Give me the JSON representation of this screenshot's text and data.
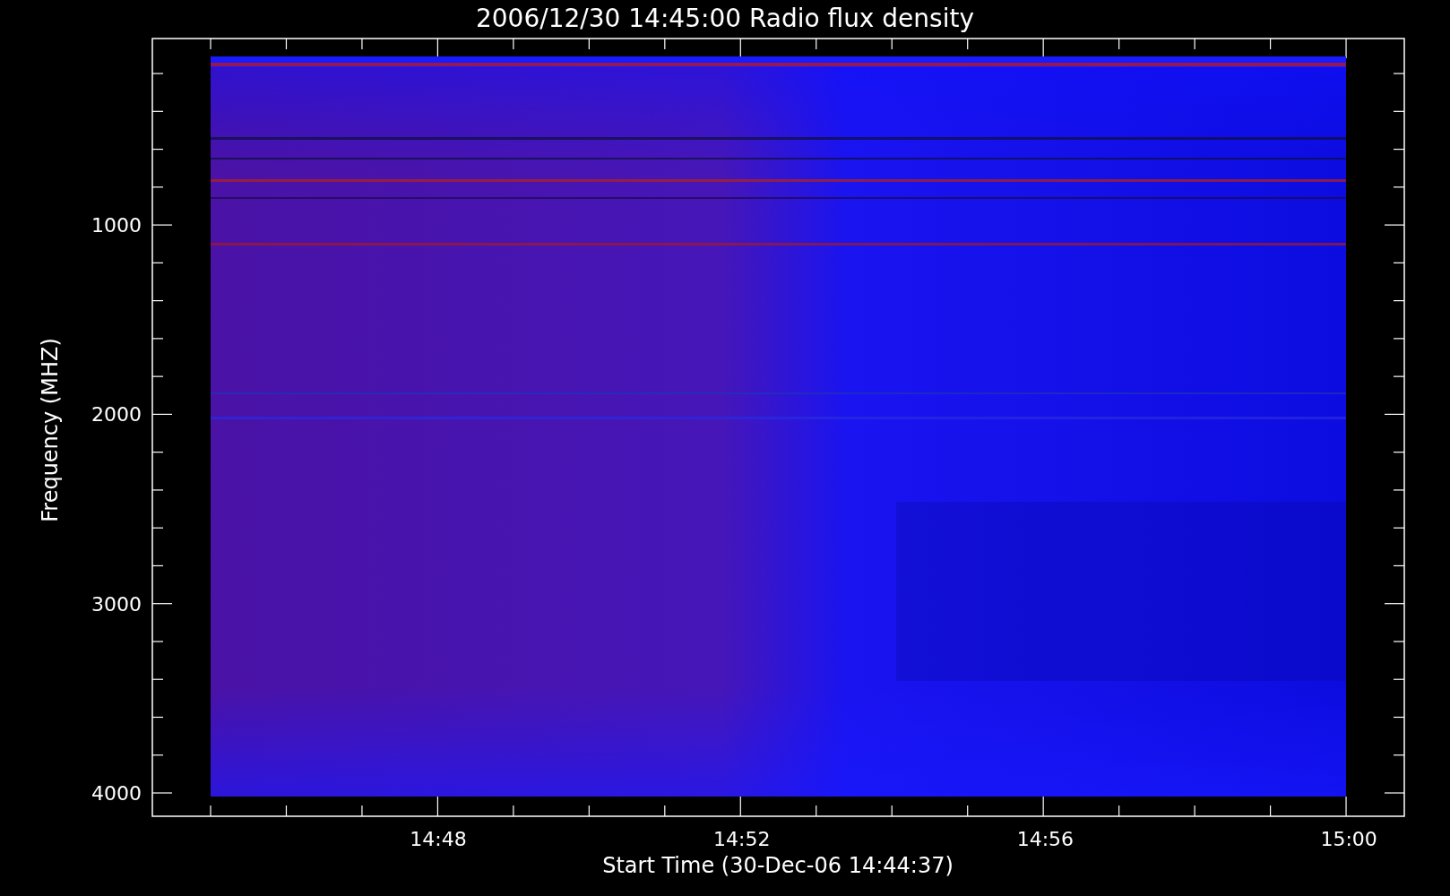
{
  "title": "2006/12/30 14:45:00 Radio flux density",
  "y_axis": {
    "label": "Frequency (MHZ)",
    "tick_labels": [
      "1000",
      "2000",
      "3000",
      "4000"
    ]
  },
  "x_axis": {
    "label": "Start Time (30-Dec-06 14:44:37)",
    "tick_labels": [
      "14:48",
      "14:52",
      "14:56",
      "15:00"
    ]
  }
}
